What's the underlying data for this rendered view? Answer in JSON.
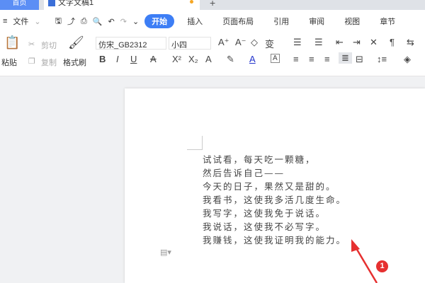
{
  "tabs": {
    "home": "首页",
    "doc": "文字文稿1",
    "new": "+"
  },
  "menu": {
    "file": "文件",
    "items": [
      "开始",
      "插入",
      "页面布局",
      "引用",
      "审阅",
      "视图",
      "章节"
    ]
  },
  "toolbar": {
    "paste": "粘贴",
    "cut": "剪切",
    "copy": "复制",
    "format_painter": "格式刷",
    "font": "仿宋_GB2312",
    "size": "小四"
  },
  "document": {
    "lines": [
      "试试看，每天吃一颗糖，",
      "然后告诉自己——",
      "今天的日子，果然又是甜的。",
      "我看书，这使我多活几度生命。",
      "我写字，这使我免于说话。",
      "我说话，这使我不必写字。",
      "我赚钱，这使我证明我的能力。"
    ]
  },
  "annotation": {
    "badge": "1",
    "color": "#e63030"
  }
}
